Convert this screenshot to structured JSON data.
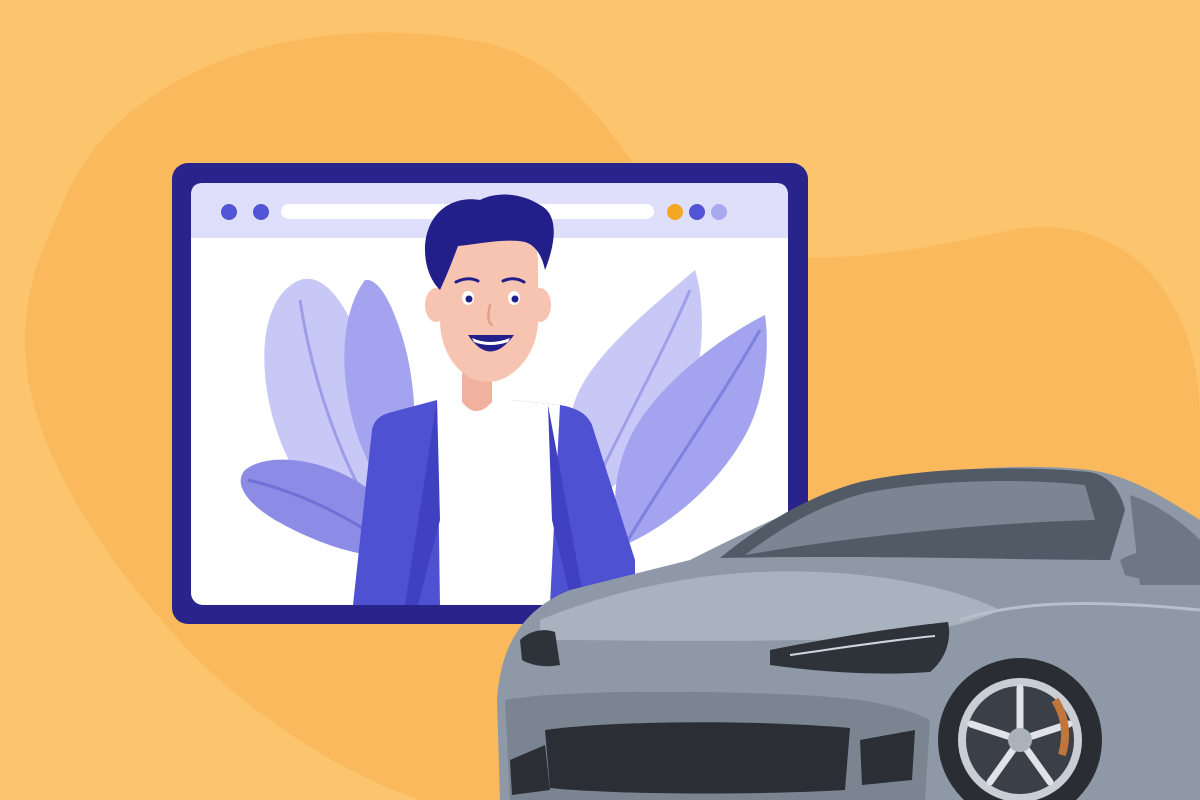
{
  "scene": {
    "description_colors": {
      "background": "#fcc46d",
      "blob": "#fbb95e",
      "window_frame": "#29238c",
      "window_bar": "#dfdffb",
      "window_body": "#ffffff",
      "dot_primary": "#5353d6",
      "dot_accent": "#f5a623",
      "dot_light": "#a9a9ef",
      "leaf_light": "#c8c8f7",
      "leaf_mid": "#a3a3ef",
      "leaf_dark": "#8c8ce6",
      "jacket": "#4f51d3",
      "shirt": "#ffffff",
      "hair": "#231f8a",
      "skin": "#f7c4b2",
      "car_body": "#8e98a6",
      "car_dark": "#3a3f47",
      "car_light": "#c5ccd6"
    },
    "icons": {
      "browser_window": "browser-window-icon",
      "person": "person-avatar-icon",
      "car": "sports-car-icon"
    }
  }
}
